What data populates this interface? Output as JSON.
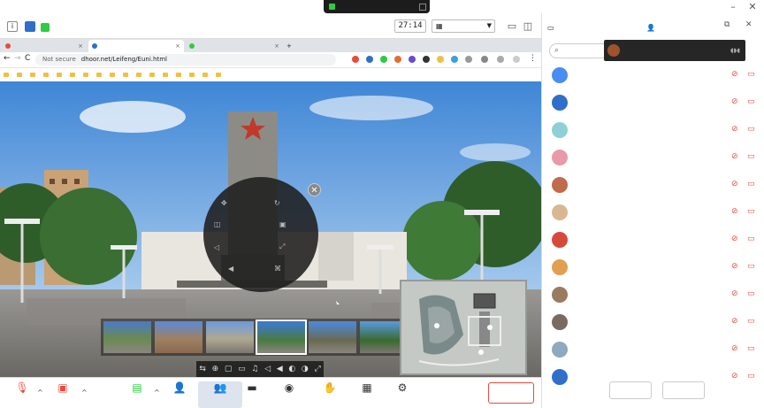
{
  "topbar": {
    "share_status": "",
    "timer": "27:14",
    "view_mode": ""
  },
  "browser": {
    "tabs": [
      {
        "label": "",
        "active": false
      },
      {
        "label": "",
        "active": true
      },
      {
        "label": "",
        "active": false
      }
    ],
    "new_tab": "+",
    "nav_back": "←",
    "nav_forward": "→",
    "nav_reload": "C",
    "not_secure": "Not secure",
    "url": "dhoor.net/Leifeng/Euni.html",
    "bookmarks": [
      "",
      "",
      "",
      "",
      "",
      "",
      "",
      "",
      "",
      "",
      "",
      "",
      "",
      "",
      "",
      "",
      ""
    ]
  },
  "viewer": {
    "radial_menu": [
      "",
      "",
      "",
      "",
      "",
      "",
      "",
      ""
    ],
    "close_symbol": "✕",
    "thumbnail_strip_title": "",
    "thumbnail_count": 6,
    "selected_thumbnail": 3,
    "control_icons": [
      "⇆",
      "⊕",
      "▢",
      "▭",
      "♫",
      "◁",
      "◀",
      "◐",
      "◑",
      "⤢"
    ]
  },
  "bottombar": {
    "mute": "",
    "video": "",
    "share": "",
    "invite": "",
    "members": "",
    "chat": "",
    "record": "",
    "raise_hand": "",
    "apps": "",
    "settings": "",
    "end_meeting": ""
  },
  "panel": {
    "chat_tab": "",
    "members_tab": "",
    "search_placeholder": "",
    "speaking_label": "",
    "participants": [
      {
        "name": "",
        "avatar_text": "",
        "avatar_color": "#4a8df0"
      },
      {
        "name": "",
        "avatar_text": "",
        "avatar_color": "#2f6ec9"
      },
      {
        "name": "",
        "avatar_text": "",
        "avatar_color": "#8fd0d8"
      },
      {
        "name": "",
        "avatar_text": "",
        "avatar_color": "#e89aa8"
      },
      {
        "name": "",
        "avatar_text": "",
        "avatar_color": "#c06b4a"
      },
      {
        "name": "",
        "avatar_text": "",
        "avatar_color": "#d8b890"
      },
      {
        "name": "",
        "avatar_text": "",
        "avatar_color": "#d74a3a"
      },
      {
        "name": "",
        "avatar_text": "",
        "avatar_color": "#e0a050"
      },
      {
        "name": "",
        "avatar_text": "",
        "avatar_color": "#9a7a60"
      },
      {
        "name": "",
        "avatar_text": "",
        "avatar_color": "#7a6a60"
      },
      {
        "name": "",
        "avatar_text": "",
        "avatar_color": "#90a8c0"
      },
      {
        "name": "",
        "avatar_text": "",
        "avatar_color": "#2f6ec9"
      }
    ],
    "mute_all": "",
    "leave": ""
  }
}
